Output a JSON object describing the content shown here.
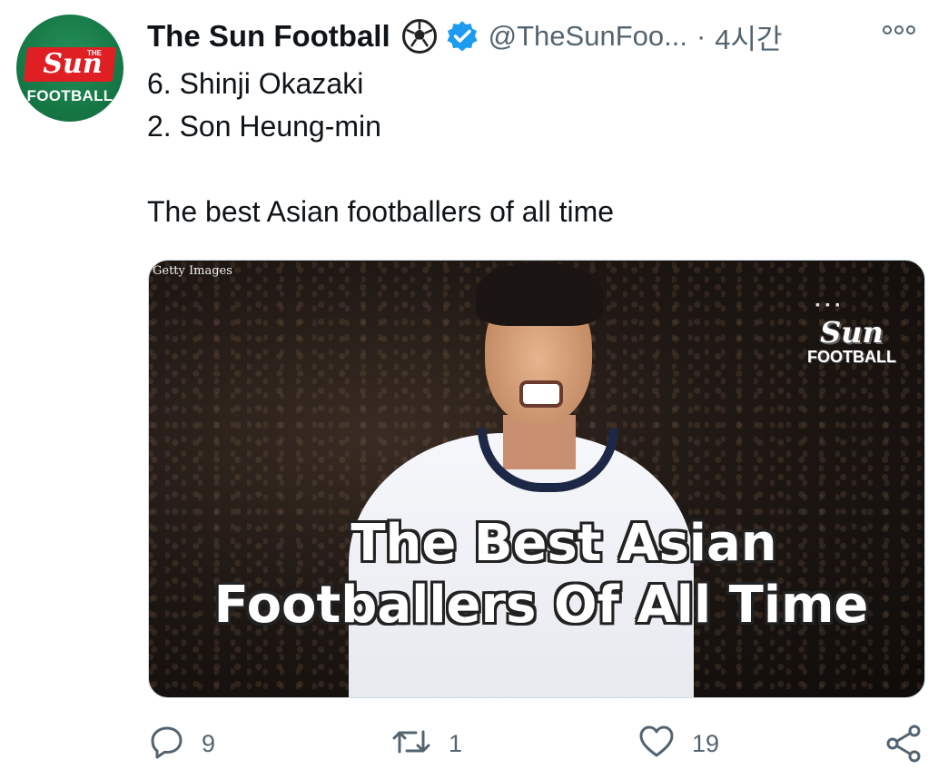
{
  "author": {
    "name": "The Sun Football",
    "handle": "@TheSunFoo...",
    "separator": "·",
    "time": "4시간",
    "avatar_text": {
      "small": "THE",
      "main": "Sun",
      "sub": "FOOTBALL"
    }
  },
  "tweet": {
    "lines": [
      "6. Shinji Okazaki",
      "2. Son Heung-min",
      "The best Asian footballers of all time"
    ]
  },
  "media": {
    "credit": "Getty Images",
    "watermark": {
      "main": "Sun",
      "sub": "FOOTBALL"
    },
    "overlay_line1": "The Best Asian",
    "overlay_line2": "Footballers Of All Time"
  },
  "actions": {
    "reply_count": "9",
    "retweet_count": "1",
    "like_count": "19"
  },
  "colors": {
    "verified": "#1d9bf0",
    "muted": "#536471",
    "avatar_green": "#177a47",
    "brand_red": "#e01f25"
  }
}
